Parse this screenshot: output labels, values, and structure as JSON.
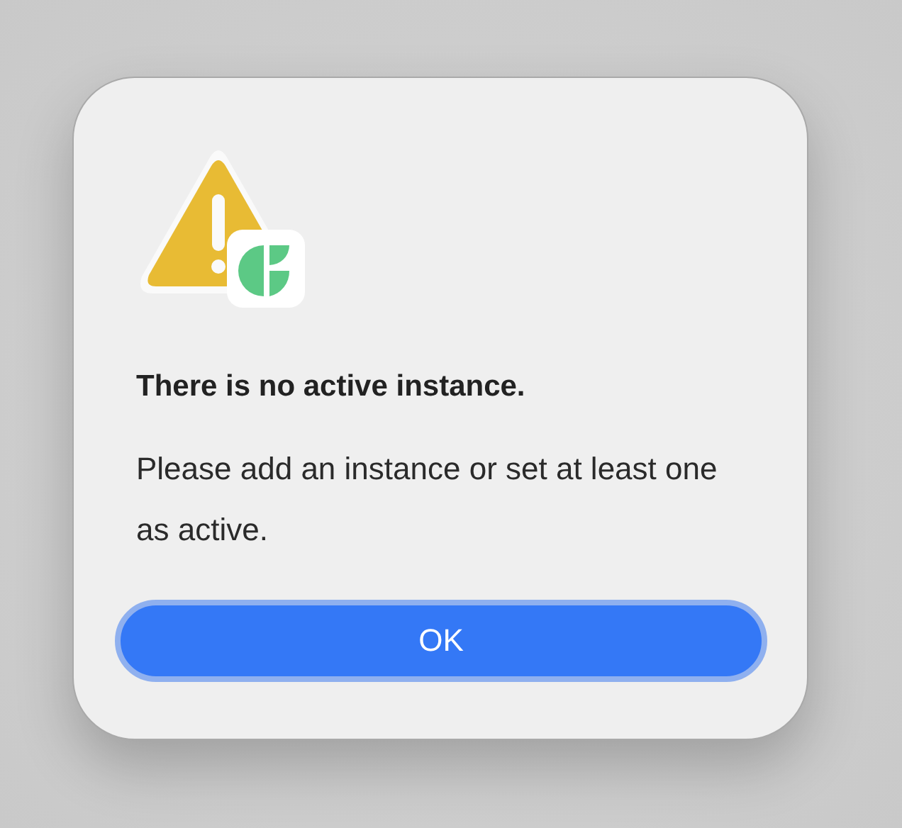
{
  "alert": {
    "title": "There is no active instance.",
    "message": "Please add an instance or set at least one as active.",
    "buttons": [
      {
        "label": "OK",
        "default": true
      }
    ]
  }
}
